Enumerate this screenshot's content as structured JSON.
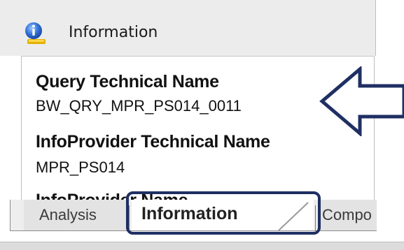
{
  "panel": {
    "title": "Information",
    "title_icon": "info-icon"
  },
  "fields": [
    {
      "label": "Query Technical Name",
      "value": "BW_QRY_MPR_PS014_0011"
    },
    {
      "label": "InfoProvider Technical Name",
      "value": "MPR_PS014"
    },
    {
      "label": "InfoProvider Name",
      "value": ""
    }
  ],
  "annotation": {
    "arrow_icon": "left-arrow-outline",
    "color": "#1f2f63"
  },
  "tabs": [
    {
      "label": "Analysis",
      "selected": false
    },
    {
      "label": "Information",
      "selected": true
    },
    {
      "label": "Compo",
      "selected": false
    }
  ],
  "colors": {
    "highlight": "#1f2f63",
    "info_icon_blue": "#2f6fd6",
    "info_icon_yellow": "#e3b000"
  }
}
